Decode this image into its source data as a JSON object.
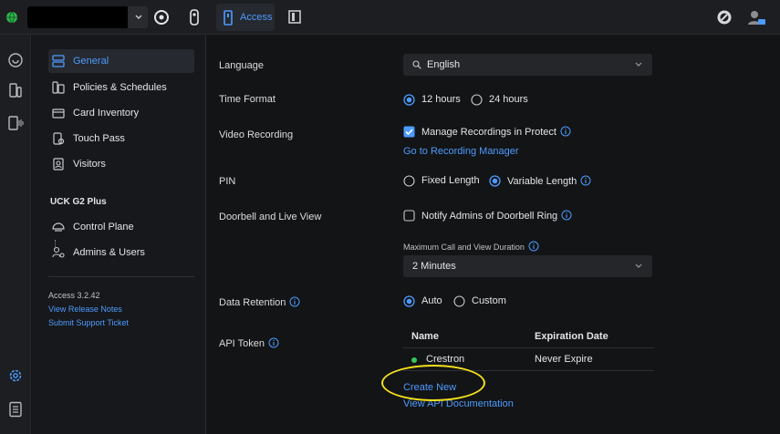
{
  "topbar": {
    "active_tab_label": "Access",
    "accent_color": "#4c9bff"
  },
  "rail": {
    "icons": [
      "protect-icon",
      "access-icon",
      "talk-icon",
      "settings-icon",
      "notes-icon"
    ]
  },
  "nav": {
    "items": [
      {
        "label": "General"
      },
      {
        "label": "Policies & Schedules"
      },
      {
        "label": "Card Inventory"
      },
      {
        "label": "Touch Pass"
      },
      {
        "label": "Visitors"
      }
    ],
    "section_title": "UCK G2 Plus",
    "section_items": [
      {
        "label": "Control Plane"
      },
      {
        "label": "Admins & Users"
      }
    ],
    "version": "Access 3.2.42",
    "release_notes": "View Release Notes",
    "support_ticket": "Submit Support Ticket"
  },
  "settings": {
    "language": {
      "label": "Language",
      "value": "English"
    },
    "time_format": {
      "label": "Time Format",
      "options": [
        "12 hours",
        "24 hours"
      ],
      "selected": "12 hours"
    },
    "video_recording": {
      "label": "Video Recording",
      "checkbox_label": "Manage Recordings in Protect",
      "checked": true,
      "link": "Go to Recording Manager"
    },
    "pin": {
      "label": "PIN",
      "options": [
        "Fixed Length",
        "Variable Length"
      ],
      "selected": "Variable Length"
    },
    "doorbell": {
      "label": "Doorbell and Live View",
      "checkbox_label": "Notify Admins of Doorbell Ring",
      "checked": false,
      "duration_label": "Maximum Call and View Duration",
      "duration_value": "2 Minutes"
    },
    "data_retention": {
      "label": "Data Retention",
      "options": [
        "Auto",
        "Custom"
      ],
      "selected": "Auto"
    },
    "api_token": {
      "label": "API Token",
      "columns": [
        "Name",
        "Expiration Date"
      ],
      "rows": [
        {
          "name": "Crestron",
          "expiration": "Never Expire",
          "status_color": "#38c75a"
        }
      ],
      "create_link": "Create New",
      "docs_link": "View API Documentation"
    }
  },
  "annotation": {
    "highlight_color": "#f2e01c"
  }
}
